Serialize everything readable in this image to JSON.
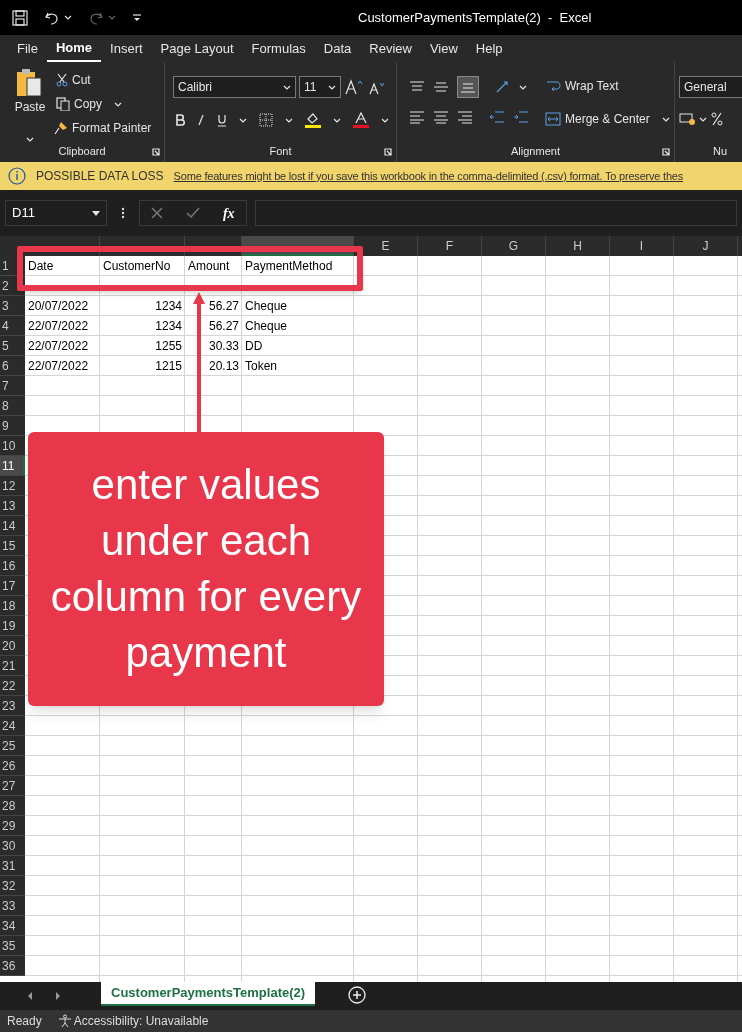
{
  "window": {
    "title": "CustomerPaymentsTemplate(2)  -  Excel"
  },
  "menu_tabs": [
    {
      "label": "File",
      "selected": false
    },
    {
      "label": "Home",
      "selected": true
    },
    {
      "label": "Insert",
      "selected": false
    },
    {
      "label": "Page Layout",
      "selected": false
    },
    {
      "label": "Formulas",
      "selected": false
    },
    {
      "label": "Data",
      "selected": false
    },
    {
      "label": "Review",
      "selected": false
    },
    {
      "label": "View",
      "selected": false
    },
    {
      "label": "Help",
      "selected": false
    }
  ],
  "ribbon": {
    "clipboard": {
      "paste": "Paste",
      "cut": "Cut",
      "copy": "Copy",
      "format_painter": "Format Painter",
      "label": "Clipboard"
    },
    "font": {
      "name": "Calibri",
      "size": "11",
      "label": "Font"
    },
    "alignment": {
      "wrap_text": "Wrap Text",
      "merge_center": "Merge & Center",
      "label": "Alignment"
    },
    "number": {
      "format": "General",
      "label": "Nu"
    }
  },
  "info_bar": {
    "title": "POSSIBLE DATA LOSS",
    "message": "Some features might be lost if you save this workbook in the comma-delimited (.csv) format. To preserve thes"
  },
  "formula_bar": {
    "name_box": "D11",
    "fx": "fx"
  },
  "columns": [
    {
      "selected": false
    },
    {
      "selected": false
    },
    {
      "selected": false
    },
    {
      "selected": true
    },
    {
      "label": "E",
      "selected": false
    },
    {
      "label": "F",
      "selected": false
    },
    {
      "label": "G",
      "selected": false
    },
    {
      "label": "H",
      "selected": false
    },
    {
      "label": "I",
      "selected": false
    },
    {
      "label": "J",
      "selected": false
    }
  ],
  "rows": [
    {
      "number": "1",
      "selected": false,
      "cells": [
        "Date",
        "CustomerNo",
        "Amount",
        "PaymentMethod"
      ]
    },
    {
      "number": "2",
      "selected": false
    },
    {
      "number": "3",
      "selected": false,
      "cells": [
        "20/07/2022",
        "1234",
        "56.27",
        "Cheque"
      ]
    },
    {
      "number": "4",
      "selected": false,
      "cells": [
        "22/07/2022",
        "1234",
        "56.27",
        "Cheque"
      ]
    },
    {
      "number": "5",
      "selected": false,
      "cells": [
        "22/07/2022",
        "1255",
        "30.33",
        "DD"
      ]
    },
    {
      "number": "6",
      "selected": false,
      "cells": [
        "22/07/2022",
        "1215",
        "20.13",
        "Token"
      ]
    },
    {
      "number": "7",
      "selected": false
    },
    {
      "number": "8",
      "selected": false
    },
    {
      "number": "9",
      "selected": false
    },
    {
      "number": "10",
      "selected": false
    },
    {
      "number": "11",
      "selected": true
    },
    {
      "number": "12",
      "selected": false
    },
    {
      "number": "13",
      "selected": false
    },
    {
      "number": "14",
      "selected": false
    },
    {
      "number": "15",
      "selected": false
    },
    {
      "number": "16",
      "selected": false
    },
    {
      "number": "17",
      "selected": false
    },
    {
      "number": "18",
      "selected": false
    },
    {
      "number": "19",
      "selected": false
    },
    {
      "number": "20",
      "selected": false
    },
    {
      "number": "21",
      "selected": false
    },
    {
      "number": "22",
      "selected": false
    },
    {
      "number": "23",
      "selected": false
    },
    {
      "number": "24",
      "selected": false
    },
    {
      "number": "25",
      "selected": false
    },
    {
      "number": "26",
      "selected": false
    },
    {
      "number": "27",
      "selected": false
    },
    {
      "number": "28",
      "selected": false
    },
    {
      "number": "29",
      "selected": false
    },
    {
      "number": "30",
      "selected": false
    },
    {
      "number": "31",
      "selected": false
    },
    {
      "number": "32",
      "selected": false
    },
    {
      "number": "33",
      "selected": false
    },
    {
      "number": "34",
      "selected": false
    },
    {
      "number": "35",
      "selected": false
    },
    {
      "number": "36",
      "selected": false
    }
  ],
  "callout": {
    "text": "enter values under each column for every payment"
  },
  "sheet_tabs": [
    {
      "label": "CustomerPaymentsTemplate(2)",
      "selected": true
    }
  ],
  "status_bar": {
    "status": "Ready",
    "accessibility": "Accessibility: Unavailable"
  }
}
